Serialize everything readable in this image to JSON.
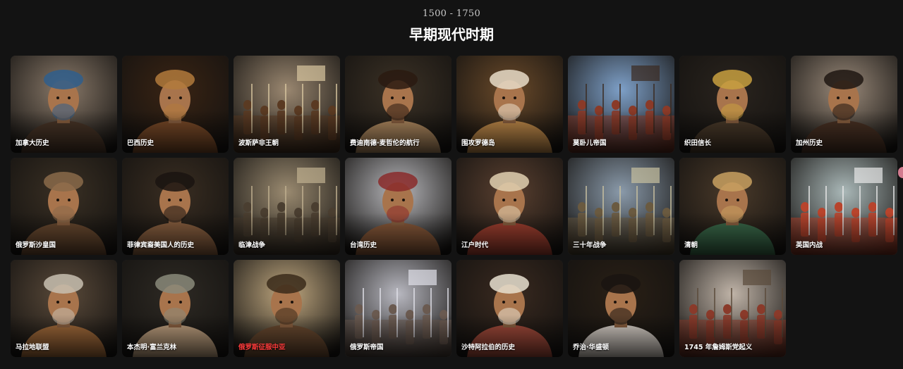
{
  "header": {
    "range": "1500 - 1750",
    "title": "早期现代时期"
  },
  "cards": [
    {
      "label": "加拿大历史",
      "icon": "portrait-native-elder",
      "bg": "#8a7a6a",
      "fg": "#4a3628",
      "accent": "#2f5e8c"
    },
    {
      "label": "巴西历史",
      "icon": "portrait-warrior",
      "bg": "#3a2414",
      "fg": "#7a4a28",
      "accent": "#b27a3c"
    },
    {
      "label": "波斯萨非王朝",
      "icon": "horseman",
      "bg": "#9a8770",
      "fg": "#5a3a22",
      "accent": "#d8c6a0"
    },
    {
      "label": "费迪南德·麦哲伦的航行",
      "icon": "portrait-bearded-hat",
      "bg": "#3c3226",
      "fg": "#b08a60",
      "accent": "#2a1a10"
    },
    {
      "label": "围攻罗德岛",
      "icon": "portrait-turban-throne",
      "bg": "#6a4a2a",
      "fg": "#c08a4a",
      "accent": "#e8dcc8"
    },
    {
      "label": "莫卧儿帝国",
      "icon": "fort-cavalry",
      "bg": "#7ea0c8",
      "fg": "#8a3a28",
      "accent": "#3a2a20"
    },
    {
      "label": "织田信长",
      "icon": "samurai-armor",
      "bg": "#2a241e",
      "fg": "#4a3a2a",
      "accent": "#c8a040"
    },
    {
      "label": "加州历史",
      "icon": "portrait-couple",
      "bg": "#9a8a7a",
      "fg": "#4a3224",
      "accent": "#1e1612"
    },
    {
      "label": "俄罗斯沙皇国",
      "icon": "portrait-fur-hat",
      "bg": "#3a3024",
      "fg": "#6a4a30",
      "accent": "#8a6a4a"
    },
    {
      "label": "菲律宾裔美国人的历史",
      "icon": "portrait-man",
      "bg": "#3a2e22",
      "fg": "#8a6040",
      "accent": "#1a1410"
    },
    {
      "label": "临津战争",
      "icon": "armored-soldiers",
      "bg": "#9a8a70",
      "fg": "#4a3e30",
      "accent": "#c0b090"
    },
    {
      "label": "台湾历史",
      "icon": "portrait-monk",
      "bg": "#b8b8bc",
      "fg": "#8a5a3a",
      "accent": "#8a2a2a"
    },
    {
      "label": "江户时代",
      "icon": "scholar-writing",
      "bg": "#5a4030",
      "fg": "#a04030",
      "accent": "#e0d0b0"
    },
    {
      "label": "三十年战争",
      "icon": "battle-scene",
      "bg": "#8a9aaa",
      "fg": "#6a5a40",
      "accent": "#c8c0a0"
    },
    {
      "label": "清朝",
      "icon": "portrait-empress",
      "bg": "#4a3a2a",
      "fg": "#3a6a4a",
      "accent": "#c8a060"
    },
    {
      "label": "英国内战",
      "icon": "battle-flag",
      "bg": "#aab8b8",
      "fg": "#b8442c",
      "accent": "#e8e8e8"
    },
    {
      "label": "马拉地联盟",
      "icon": "portrait-turban",
      "bg": "#5a4a3a",
      "fg": "#a06a3a",
      "accent": "#c8c0b0"
    },
    {
      "label": "本杰明·富兰克林",
      "icon": "portrait-franklin",
      "bg": "#2e2a24",
      "fg": "#c0a080",
      "accent": "#8a8a7a"
    },
    {
      "label": "俄罗斯征服中亚",
      "icon": "portrait-turban-beard",
      "bg": "#c0a880",
      "fg": "#6a4a30",
      "accent": "#3a2a1a",
      "red": true
    },
    {
      "label": "俄罗斯帝国",
      "icon": "army-formation",
      "bg": "#b8b8c0",
      "fg": "#6a5a50",
      "accent": "#e0e0e8"
    },
    {
      "label": "沙特阿拉伯的历史",
      "icon": "portrait-keffiyeh",
      "bg": "#3a2a20",
      "fg": "#a04a3a",
      "accent": "#e8e0d0"
    },
    {
      "label": "乔治·华盛顿",
      "icon": "portrait-washington",
      "bg": "#2a2016",
      "fg": "#d8d0c8",
      "accent": "#1a1410"
    },
    {
      "label": "1745 年詹姆斯党起义",
      "icon": "highlander-charge",
      "bg": "#c0b4a8",
      "fg": "#8a3a2a",
      "accent": "#5a4a3a"
    }
  ]
}
